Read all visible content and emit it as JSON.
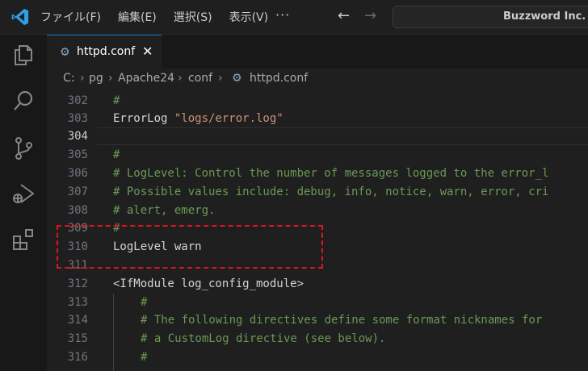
{
  "titlebar": {
    "menu": [
      "ファイル(F)",
      "編集(E)",
      "選択(S)",
      "表示(V)"
    ],
    "more": "···",
    "search_text": "Buzzword Inc."
  },
  "tab": {
    "name": "httpd.conf",
    "close": "✕"
  },
  "breadcrumb": [
    "C:",
    "pg",
    "Apache24",
    "conf",
    "httpd.conf"
  ],
  "editor": {
    "active_line": 304,
    "lines": [
      {
        "n": "302",
        "text": "#"
      },
      {
        "n": "303",
        "text": "ErrorLog \"logs/error.log\""
      },
      {
        "n": "304",
        "text": ""
      },
      {
        "n": "305",
        "text": "#"
      },
      {
        "n": "306",
        "text": "# LogLevel: Control the number of messages logged to the error_l"
      },
      {
        "n": "307",
        "text": "# Possible values include: debug, info, notice, warn, error, cri"
      },
      {
        "n": "308",
        "text": "# alert, emerg."
      },
      {
        "n": "309",
        "text": "#"
      },
      {
        "n": "310",
        "text": "LogLevel warn"
      },
      {
        "n": "311",
        "text": ""
      },
      {
        "n": "312",
        "text": "<IfModule log_config_module>"
      },
      {
        "n": "313",
        "text": "#"
      },
      {
        "n": "314",
        "text": "# The following directives define some format nicknames for"
      },
      {
        "n": "315",
        "text": "# a CustomLog directive (see below)."
      },
      {
        "n": "316",
        "text": "#"
      }
    ]
  },
  "colors": {
    "accent": "#0078d4",
    "highlight_box": "#e0141e",
    "comment": "#6a9955",
    "string": "#ce9178"
  }
}
